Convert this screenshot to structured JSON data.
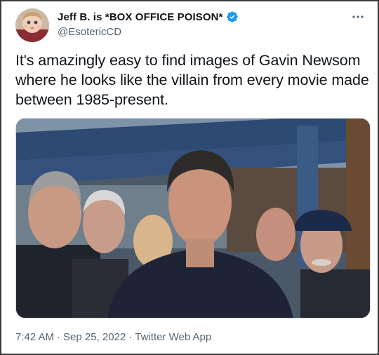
{
  "tweet": {
    "display_name": "Jeff B. is *BOX OFFICE POISON*",
    "handle": "@EsotericCD",
    "verified": true,
    "text": "It's amazingly easy to find images of Gavin Newsom where he looks like the villain from every movie made between 1985-present.",
    "time": "7:42 AM",
    "date": "Sep 25, 2022",
    "source": "Twitter Web App",
    "separator": "·"
  },
  "icons": {
    "more": "more-horizontal-icon",
    "verified": "verified-badge-icon"
  },
  "colors": {
    "verified_blue": "#1d9bf0",
    "text": "#0f1419",
    "secondary": "#536471"
  }
}
